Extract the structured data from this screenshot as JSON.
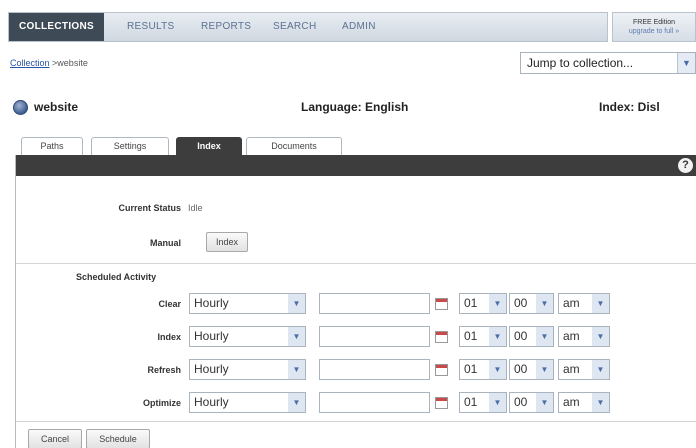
{
  "nav": {
    "tabs": [
      "COLLECTIONS",
      "RESULTS",
      "REPORTS",
      "SEARCH",
      "ADMIN"
    ],
    "edition_title": "FREE Edition",
    "edition_upgrade": "upgrade to full »"
  },
  "breadcrumb": {
    "link": "Collection",
    "current": ">website"
  },
  "jump": {
    "label": "Jump to collection..."
  },
  "header": {
    "collection": "website",
    "language": "Language: English",
    "index": "Index: Disl"
  },
  "tabs": [
    "Paths",
    "Settings",
    "Index",
    "Documents"
  ],
  "panel": {
    "current_status_label": "Current Status",
    "current_status_value": "Idle",
    "manual_label": "Manual",
    "index_button": "Index",
    "scheduled_label": "Scheduled Activity",
    "rows": [
      {
        "label": "Clear",
        "freq": "Hourly",
        "hour": "01",
        "minute": "00",
        "ampm": "am"
      },
      {
        "label": "Index",
        "freq": "Hourly",
        "hour": "01",
        "minute": "00",
        "ampm": "am"
      },
      {
        "label": "Refresh",
        "freq": "Hourly",
        "hour": "01",
        "minute": "00",
        "ampm": "am"
      },
      {
        "label": "Optimize",
        "freq": "Hourly",
        "hour": "01",
        "minute": "00",
        "ampm": "am"
      }
    ],
    "cancel_button": "Cancel",
    "schedule_button": "Schedule"
  },
  "colors": {
    "accent": "#3d3d3d",
    "link": "#2b53a6",
    "nav_text": "#5c7190"
  }
}
